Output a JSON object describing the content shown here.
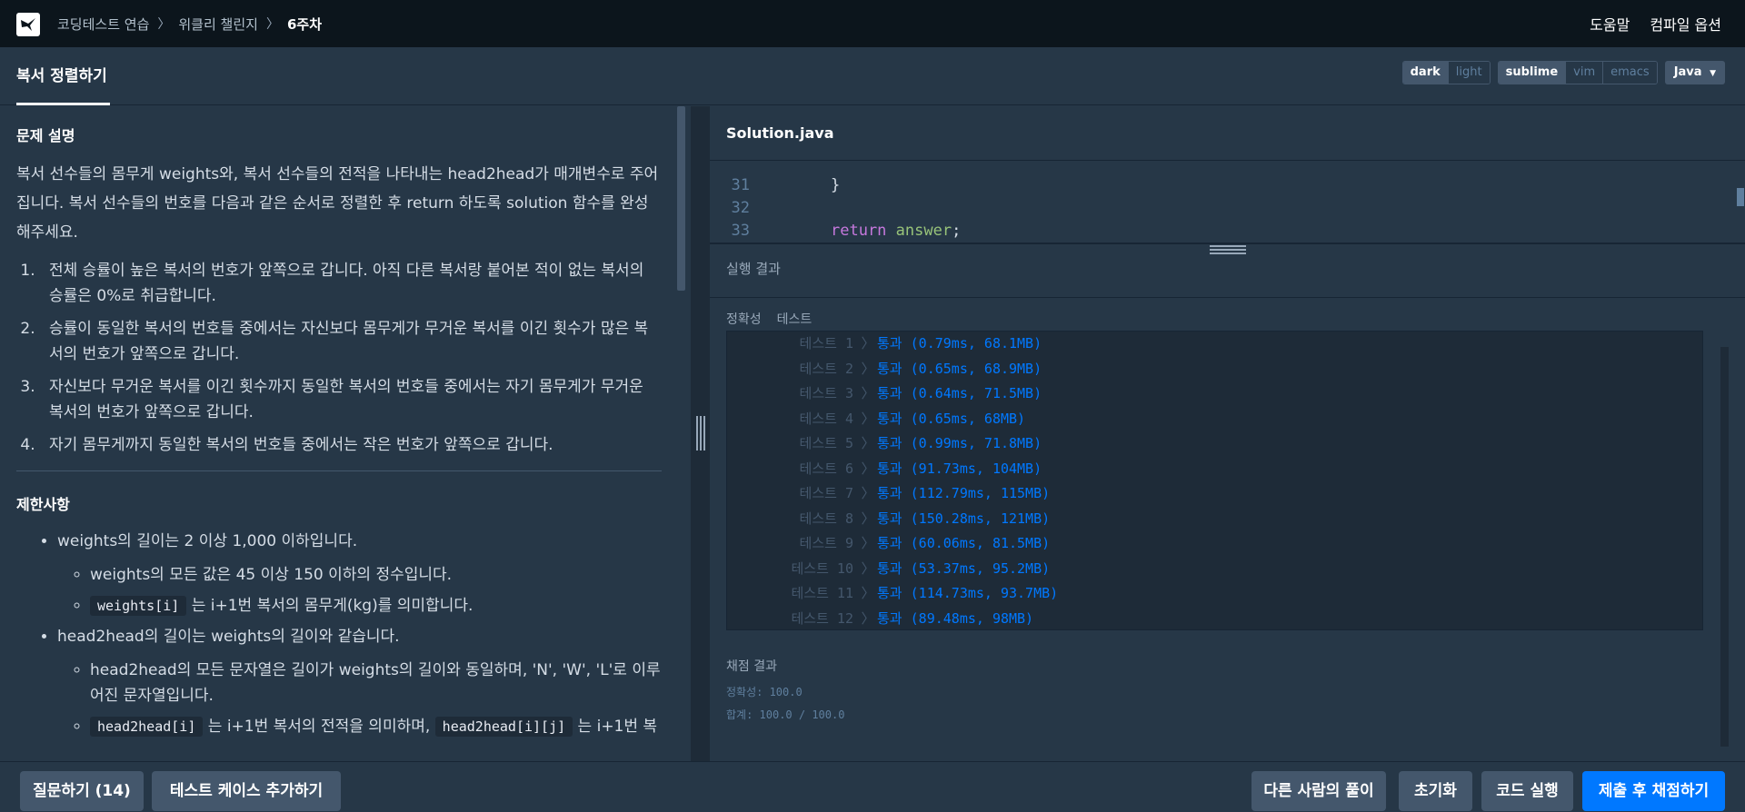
{
  "nav": {
    "logo_icon": "programmers-logo-icon",
    "breadcrumbs": [
      "코딩테스트 연습",
      "위클리 챌린지",
      "6주차"
    ],
    "help": "도움말",
    "compile_options": "컴파일 옵션"
  },
  "tab": {
    "title": "복서 정렬하기",
    "theme": [
      "dark",
      "light"
    ],
    "keymap": [
      "sublime",
      "vim",
      "emacs"
    ],
    "language": "Java"
  },
  "problem": {
    "desc_title": "문제 설명",
    "desc": "복서 선수들의 몸무게 weights와, 복서 선수들의 전적을 나타내는 head2head가 매개변수로 주어집니다. 복서 선수들의 번호를 다음과 같은 순서로 정렬한 후 return 하도록 solution 함수를 완성해주세요.",
    "rules": [
      "전체 승률이 높은 복서의 번호가 앞쪽으로 갑니다. 아직 다른 복서랑 붙어본 적이 없는 복서의 승률은 0%로 취급합니다.",
      "승률이 동일한 복서의 번호들 중에서는 자신보다 몸무게가 무거운 복서를 이긴 횟수가 많은 복서의 번호가 앞쪽으로 갑니다.",
      "자신보다 무거운 복서를 이긴 횟수까지 동일한 복서의 번호들 중에서는 자기 몸무게가 무거운 복서의 번호가 앞쪽으로 갑니다.",
      "자기 몸무게까지 동일한 복서의 번호들 중에서는 작은 번호가 앞쪽으로 갑니다."
    ],
    "limits_title": "제한사항",
    "limit1": "weights의 길이는 2 이상 1,000 이하입니다.",
    "limit1_sub1": "weights의 모든 값은 45 이상 150 이하의 정수입니다.",
    "limit1_sub2_code": "weights[i]",
    "limit1_sub2_text": "는 i+1번 복서의 몸무게(kg)를 의미합니다.",
    "limit2": "head2head의 길이는 weights의 길이와 같습니다.",
    "limit2_sub1": "head2head의 모든 문자열은 길이가 weights의 길이와 동일하며, 'N', 'W', 'L'로 이루어진 문자열입니다.",
    "limit2_sub2_code1": "head2head[i]",
    "limit2_sub2_text1": "는 i+1번 복서의 전적을 의미하며,",
    "limit2_sub2_code2": "head2head[i][j]",
    "limit2_sub2_text2": "는 i+1번 복"
  },
  "editor": {
    "file_name": "Solution.java",
    "lines": [
      {
        "num": "31",
        "text": "}"
      },
      {
        "num": "32",
        "text": ""
      },
      {
        "num": "33",
        "kw": "return",
        "var": "answer",
        "end": ";"
      }
    ]
  },
  "results": {
    "title": "실행 결과",
    "tabs": [
      "정확성",
      "테스트"
    ],
    "tests": [
      {
        "name": "테스트 1",
        "result": "통과 (0.79ms, 68.1MB)"
      },
      {
        "name": "테스트 2",
        "result": "통과 (0.65ms, 68.9MB)"
      },
      {
        "name": "테스트 3",
        "result": "통과 (0.64ms, 71.5MB)"
      },
      {
        "name": "테스트 4",
        "result": "통과 (0.65ms, 68MB)"
      },
      {
        "name": "테스트 5",
        "result": "통과 (0.99ms, 71.8MB)"
      },
      {
        "name": "테스트 6",
        "result": "통과 (91.73ms, 104MB)"
      },
      {
        "name": "테스트 7",
        "result": "통과 (112.79ms, 115MB)"
      },
      {
        "name": "테스트 8",
        "result": "통과 (150.28ms, 121MB)"
      },
      {
        "name": "테스트 9",
        "result": "통과 (60.06ms, 81.5MB)"
      },
      {
        "name": "테스트 10",
        "result": "통과 (53.37ms, 95.2MB)"
      },
      {
        "name": "테스트 11",
        "result": "통과 (114.73ms, 93.7MB)"
      },
      {
        "name": "테스트 12",
        "result": "통과 (89.48ms, 98MB)"
      }
    ],
    "grade_title": "채점 결과",
    "accuracy": "정확성: 100.0",
    "total": "합계: 100.0 / 100.0"
  },
  "bottom": {
    "ask": "질문하기 (14)",
    "add_case": "테스트 케이스 추가하기",
    "others": "다른 사람의 풀이",
    "reset": "초기화",
    "run": "코드 실행",
    "submit": "제출 후 채점하기"
  },
  "colors": {
    "accent": "#0078ff",
    "background": "#263747",
    "topbar": "#0c151c"
  }
}
